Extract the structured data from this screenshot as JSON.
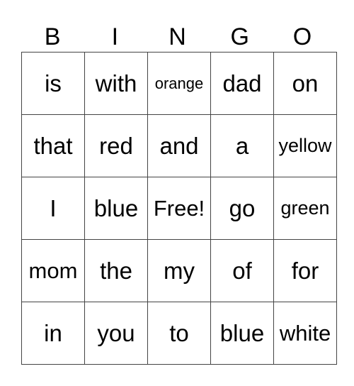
{
  "title_letters": [
    "B",
    "I",
    "N",
    "G",
    "O"
  ],
  "board": [
    [
      "is",
      "with",
      "orange",
      "dad",
      "on"
    ],
    [
      "that",
      "red",
      "and",
      "a",
      "yellow"
    ],
    [
      "I",
      "blue",
      "Free!",
      "go",
      "green"
    ],
    [
      "mom",
      "the",
      "my",
      "of",
      "for"
    ],
    [
      "in",
      "you",
      "to",
      "blue",
      "white"
    ]
  ]
}
